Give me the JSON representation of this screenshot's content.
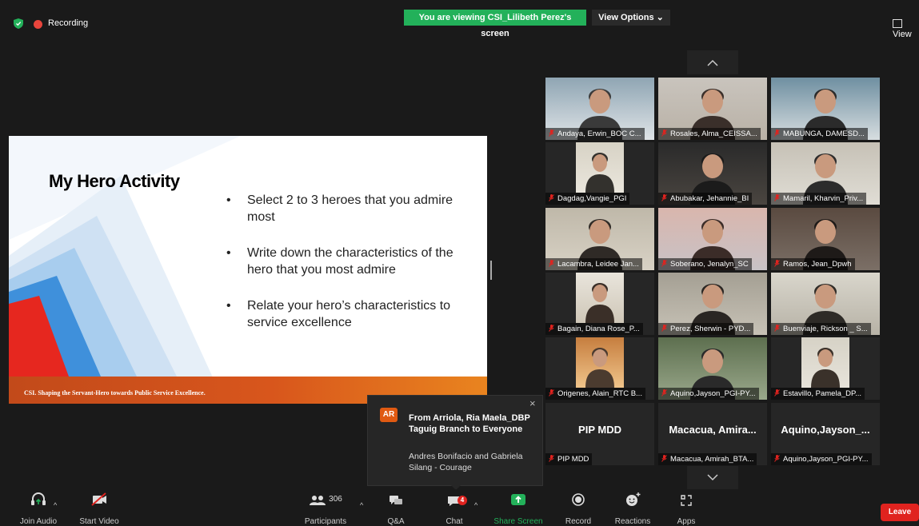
{
  "top": {
    "recording_label": "Recording",
    "viewing_banner": "You are viewing CSI_Lilibeth Perez's screen",
    "view_options": "View Options ⌄",
    "view_right": "View"
  },
  "slide": {
    "title": "My Hero Activity",
    "bullets": [
      "Select 2 to 3 heroes that you admire most",
      "Write down the characteristics of the hero that you most admire",
      "Relate your hero’s characteristics to service excellence"
    ],
    "footer": "CSI. Shaping the Servant-Hero towards Public Service Excellence."
  },
  "participants": [
    {
      "name": "Andaya, Erwin_BOC C..."
    },
    {
      "name": "Rosales, Alma_CEISSA..."
    },
    {
      "name": "MABUNGA, DAMESD..."
    },
    {
      "name": "Dagdag,Vangie_PGI"
    },
    {
      "name": "Abubakar, Jehannie_BI"
    },
    {
      "name": "Mamaril, Kharvin_Priv..."
    },
    {
      "name": "Lacambra, Leidee Jan..."
    },
    {
      "name": "Soberano, Jenalyn_SC"
    },
    {
      "name": "Ramos, Jean_Dpwh"
    },
    {
      "name": "Bagain, Diana Rose_P..."
    },
    {
      "name": "Perez, Sherwin - PYD..."
    },
    {
      "name": "Buenviaje, Rickson _ S..."
    },
    {
      "name": "Origenes, Alain_RTC B..."
    },
    {
      "name": "Aquino,Jayson_PGI-PY..."
    },
    {
      "name": "Estavillo, Pamela_DP..."
    },
    {
      "name": "PIP MDD",
      "big": "PIP MDD"
    },
    {
      "name": "Macacua, Amirah_BTA...",
      "big": "Macacua,  Amira..."
    },
    {
      "name": "Aquino,Jayson_PGI-PY...",
      "big": "Aquino,Jayson_..."
    }
  ],
  "chat_popup": {
    "initials": "AR",
    "from": "From Arriola, Ria Maela_DBP Taguig Branch to Everyone",
    "message": "Andres Bonifacio and Gabriela Silang - Courage",
    "close": "×"
  },
  "toolbar": {
    "join_audio": "Join Audio",
    "start_video": "Start Video",
    "participants": "Participants",
    "participants_count": "306",
    "qa": "Q&A",
    "chat": "Chat",
    "chat_badge": "4",
    "share_screen": "Share Screen",
    "record": "Record",
    "reactions": "Reactions",
    "apps": "Apps",
    "leave": "Leave"
  },
  "colors": {
    "share_green": "#23b15a",
    "leave_red": "#e0231f",
    "footer_orange": "#d8561c",
    "mute_red": "#e0231f"
  }
}
